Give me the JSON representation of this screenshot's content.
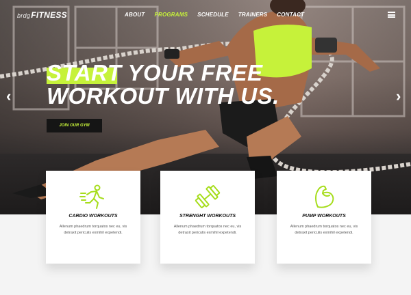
{
  "brand": {
    "prefix": "brdg",
    "name": "FITNESS"
  },
  "nav": {
    "items": [
      {
        "label": "ABOUT",
        "active": false
      },
      {
        "label": "PROGRAMS",
        "active": true
      },
      {
        "label": "SCHEDULE",
        "active": false
      },
      {
        "label": "TRAINERS",
        "active": false
      },
      {
        "label": "CONTACT",
        "active": false
      }
    ],
    "menu_icon": "hamburger-menu-icon"
  },
  "hero": {
    "headline_line1_highlight": "START",
    "headline_line1_rest": " YOUR FREE",
    "headline_line2": "WORKOUT WITH US.",
    "cta_label": "JOIN OUR GYM",
    "prev_arrow": "‹",
    "next_arrow": "›"
  },
  "cards": [
    {
      "icon": "running-person-icon",
      "title": "CARDIO WORKOUTS",
      "text": "Allenum phaedrum torquatos nec eu, vis detraxit periculis exmihil expetendi."
    },
    {
      "icon": "dumbbell-icon",
      "title": "STRENGHT WORKOUTS",
      "text": "Allenum phaedrum torquatos nec eu, vis detraxit periculis exmihil expetendi."
    },
    {
      "icon": "flexed-arm-icon",
      "title": "PUMP WORKOUTS",
      "text": "Allenum phaedrum torquatos nec eu, vis detraxit periculis exmihil expetendi."
    }
  ],
  "colors": {
    "accent": "#c6f23a",
    "dark": "#151515",
    "page_bg": "#f4f4f4"
  }
}
